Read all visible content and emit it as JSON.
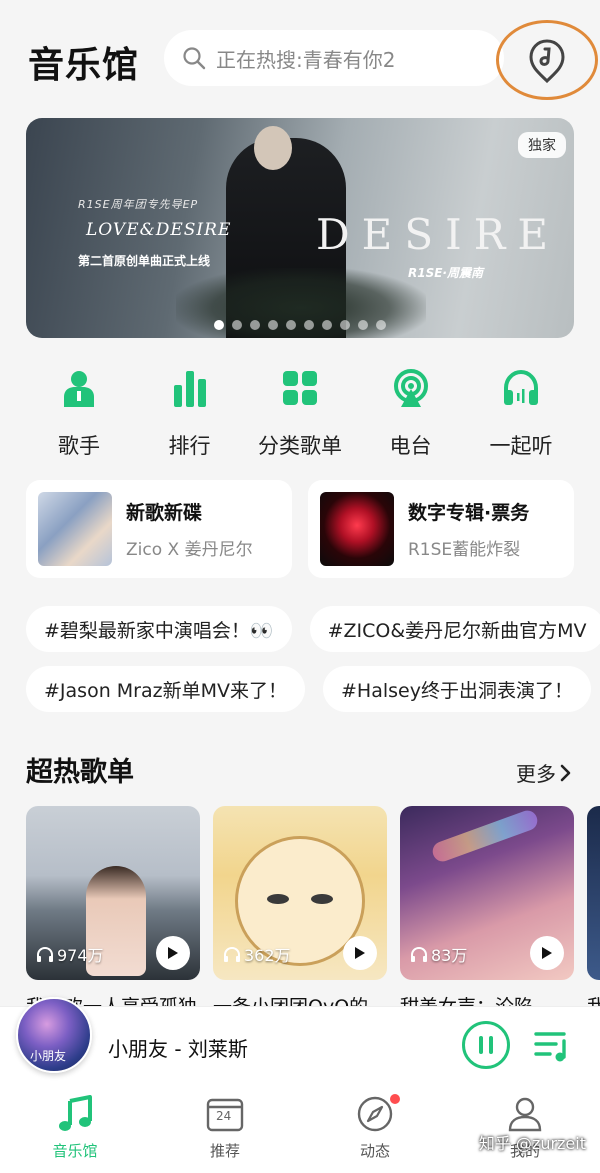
{
  "header": {
    "title": "音乐馆",
    "search_placeholder": "正在热搜:青春有你2",
    "recognize_icon": "music-recognize-icon"
  },
  "banner": {
    "subtitle_line1": "R1SE周年团专先导EP",
    "subtitle_line2": "LOVE&DESIRE",
    "subtitle_line3": "第二首原创单曲正式上线",
    "big_text": "DESIRE",
    "brand": "R1SE·周震南",
    "badge": "独家",
    "dots_total": 10,
    "dots_active_index": 0
  },
  "categories": [
    {
      "label": "歌手",
      "icon": "singer-icon"
    },
    {
      "label": "排行",
      "icon": "chart-bars-icon"
    },
    {
      "label": "分类歌单",
      "icon": "grid-icon"
    },
    {
      "label": "电台",
      "icon": "radio-icon"
    },
    {
      "label": "一起听",
      "icon": "headphones-icon"
    }
  ],
  "cards": [
    {
      "title": "新歌新碟",
      "subtitle": "Zico X 姜丹尼尔"
    },
    {
      "title": "数字专辑·票务",
      "subtitle": "R1SE蓄能炸裂"
    }
  ],
  "tags": {
    "row1": [
      "#碧梨最新家中演唱会！👀",
      "#ZICO&姜丹尼尔新曲官方MV"
    ],
    "row2": [
      "#Jason Mraz新单MV来了！",
      "#Halsey终于出洞表演了！"
    ]
  },
  "hot_playlists": {
    "title": "超热歌单",
    "more": "更多",
    "items": [
      {
        "count": "974万",
        "name": "我喜欢一人享受孤独"
      },
      {
        "count": "362万",
        "name": "一条小团团OvO的"
      },
      {
        "count": "83万",
        "name": "甜美女声：沦陷"
      },
      {
        "count": "",
        "name": "我"
      }
    ]
  },
  "player": {
    "now_playing": "小朋友 - 刘莱斯",
    "disc_text": "小朋友"
  },
  "tabs": [
    {
      "label": "音乐馆",
      "icon": "music-note-icon",
      "active": true
    },
    {
      "label": "推荐",
      "icon": "calendar-icon",
      "day": "24",
      "active": false
    },
    {
      "label": "动态",
      "icon": "compass-icon",
      "active": false,
      "badge": true
    },
    {
      "label": "我的",
      "icon": "user-icon",
      "active": false
    }
  ],
  "watermark": "知乎 @zurzeit",
  "colors": {
    "accent": "#21c37a",
    "highlight_ring": "#e08a3a"
  }
}
